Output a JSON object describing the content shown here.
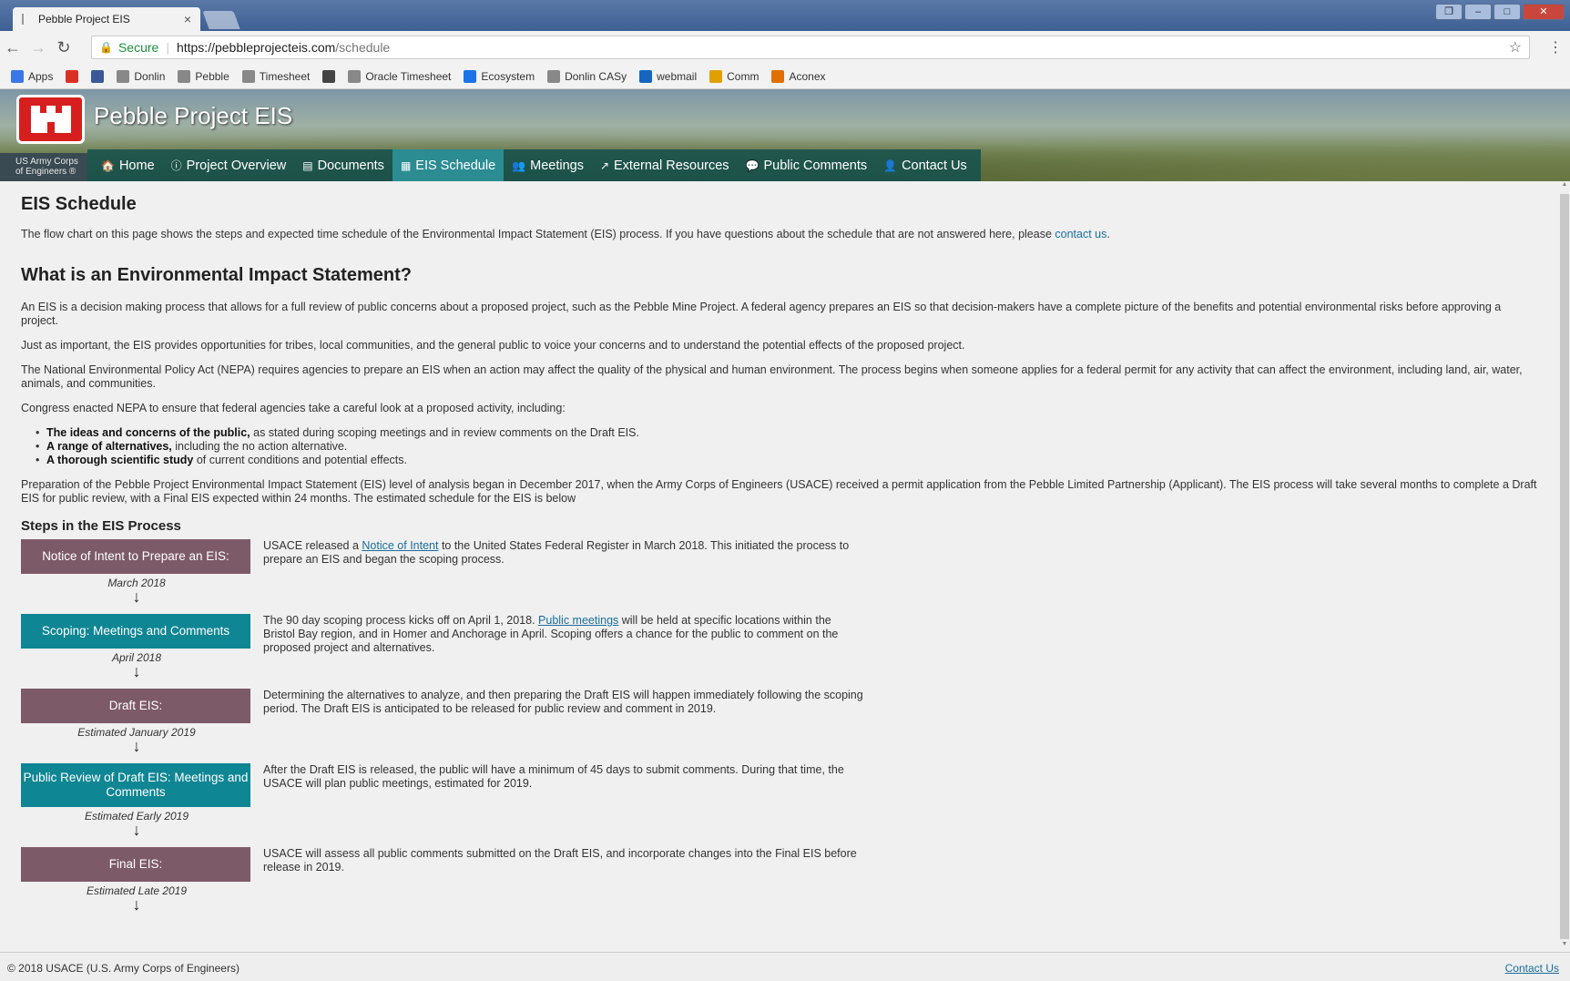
{
  "browser": {
    "tab_title": "Pebble Project EIS",
    "tab_close": "×",
    "secure_label": "Secure",
    "url_host": "https://pebbleprojecteis.com",
    "url_path": "/schedule",
    "bookmarks": [
      {
        "label": "Apps",
        "icon": "apps-grid-icon",
        "color": "#3b78e7"
      },
      {
        "label": "",
        "icon": "gmail-icon",
        "color": "#d93025"
      },
      {
        "label": "",
        "icon": "facebook-icon",
        "color": "#3b5998"
      },
      {
        "label": "Donlin",
        "icon": "page-icon",
        "color": "#888888"
      },
      {
        "label": "Pebble",
        "icon": "bar-icon",
        "color": "#888888"
      },
      {
        "label": "Timesheet",
        "icon": "page-icon",
        "color": "#888888"
      },
      {
        "label": "",
        "icon": "app-icon",
        "color": "#444444"
      },
      {
        "label": "Oracle Timesheet",
        "icon": "page-icon",
        "color": "#888888"
      },
      {
        "label": "Ecosystem",
        "icon": "doc-icon",
        "color": "#1a73e8"
      },
      {
        "label": "Donlin CASy",
        "icon": "page-icon",
        "color": "#888888"
      },
      {
        "label": "webmail",
        "icon": "mail-icon",
        "color": "#1565c0"
      },
      {
        "label": "Comm",
        "icon": "comm-icon",
        "color": "#e0a000"
      },
      {
        "label": "Aconex",
        "icon": "aconex-icon",
        "color": "#e07000"
      }
    ]
  },
  "site": {
    "title": "Pebble Project EIS",
    "corps_line1": "US Army Corps",
    "corps_line2": "of Engineers ®",
    "nav": [
      {
        "label": "Home",
        "icon": "home-icon",
        "glyph": "🏠",
        "active": false
      },
      {
        "label": "Project Overview",
        "icon": "info-icon",
        "glyph": "ⓘ",
        "active": false
      },
      {
        "label": "Documents",
        "icon": "document-icon",
        "glyph": "▤",
        "active": false
      },
      {
        "label": "EIS Schedule",
        "icon": "calendar-icon",
        "glyph": "▦",
        "active": true
      },
      {
        "label": "Meetings",
        "icon": "group-icon",
        "glyph": "👥",
        "active": false
      },
      {
        "label": "External Resources",
        "icon": "external-link-icon",
        "glyph": "↗",
        "active": false
      },
      {
        "label": "Public Comments",
        "icon": "comment-icon",
        "glyph": "💬",
        "active": false
      },
      {
        "label": "Contact Us",
        "icon": "user-icon",
        "glyph": "👤",
        "active": false
      }
    ]
  },
  "page": {
    "heading": "EIS Schedule",
    "intro_text": "The flow chart on this page shows the steps and expected time schedule of the Environmental Impact Statement (EIS) process. If you have questions about the schedule that are not answered here, please ",
    "intro_link": "contact us",
    "intro_end": ".",
    "what_heading": "What is an Environmental Impact Statement?",
    "para1": "An EIS is a decision making process that allows for a full review of public concerns about a proposed project, such as the Pebble Mine Project. A federal agency prepares an EIS so that decision-makers have a complete picture of the benefits and potential environmental risks before approving a project.",
    "para2": "Just as important, the EIS provides opportunities for tribes, local communities, and the general public to voice your concerns and to understand the potential effects of the proposed project.",
    "para3": "The National Environmental Policy Act (NEPA) requires agencies to prepare an EIS when an action may affect the quality of the physical and human environment. The process begins when someone applies for a federal permit for any activity that can affect the environment, including land, air, water, animals, and communities.",
    "para4": "Congress enacted NEPA to ensure that federal agencies take a careful look at a proposed activity, including:",
    "bullets": [
      {
        "bold": "The ideas and concerns of the public,",
        "rest": " as stated during scoping meetings and in review comments on the Draft EIS."
      },
      {
        "bold": "A range of alternatives,",
        "rest": " including the no action alternative."
      },
      {
        "bold": "A thorough scientific study",
        "rest": " of current conditions and potential effects."
      }
    ],
    "para5": "Preparation of the Pebble Project Environmental Impact Statement (EIS) level of analysis began in December 2017, when the Army Corps of Engineers (USACE) received a permit application from the Pebble Limited Partnership (Applicant). The EIS process will take several months to complete a Draft EIS for public review, with a Final EIS expected within 24 months. The estimated schedule for the EIS is below",
    "steps_heading": "Steps in the EIS Process"
  },
  "steps": [
    {
      "label": "Notice of Intent to Prepare an EIS:",
      "date": "March 2018",
      "color": "mauve",
      "desc_before": "USACE released a ",
      "desc_link": "Notice of Intent",
      "desc_after": " to the United States Federal Register in March 2018. This initiated the process to prepare an EIS and began the scoping process."
    },
    {
      "label": "Scoping: Meetings and Comments",
      "date": "April 2018",
      "color": "teal",
      "desc_before": "The 90 day scoping process kicks off on April 1, 2018. ",
      "desc_link": "Public meetings",
      "desc_after": " will be held at specific locations within the Bristol Bay region, and in Homer and Anchorage in April. Scoping offers a chance for the public to comment on the proposed project and alternatives."
    },
    {
      "label": "Draft EIS:",
      "date": "Estimated January 2019",
      "color": "mauve",
      "desc_before": "Determining the alternatives to analyze, and then preparing the Draft EIS will happen immediately following the scoping period. The Draft EIS is anticipated to be released for public review and comment in 2019.",
      "desc_link": "",
      "desc_after": ""
    },
    {
      "label": "Public Review of Draft EIS: Meetings and Comments",
      "date": "Estimated Early 2019",
      "color": "teal",
      "desc_before": "After the Draft EIS is released, the public will have a minimum of 45 days to submit comments. During that time, the USACE will plan public meetings, estimated for 2019.",
      "desc_link": "",
      "desc_after": ""
    },
    {
      "label": "Final EIS:",
      "date": "Estimated Late 2019",
      "color": "mauve",
      "desc_before": "USACE will assess all public comments submitted on the Draft EIS, and incorporate changes into the Final EIS before release in 2019.",
      "desc_link": "",
      "desc_after": ""
    }
  ],
  "footer": {
    "copyright": "© 2018 USACE (U.S. Army Corps of Engineers)",
    "contact": "Contact Us"
  }
}
